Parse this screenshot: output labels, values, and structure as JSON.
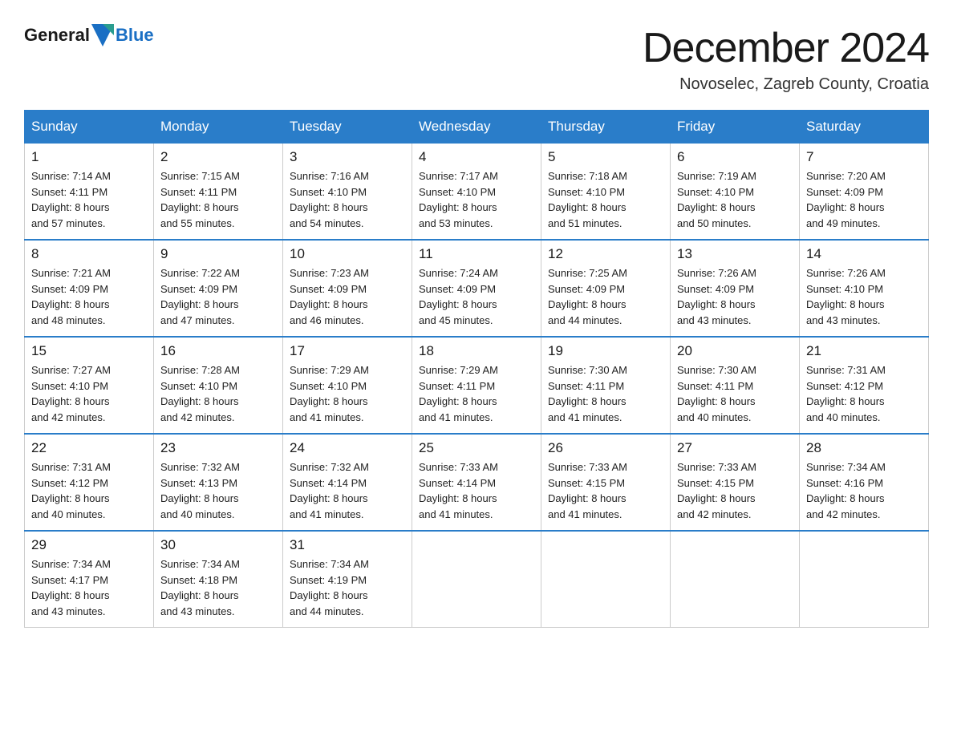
{
  "header": {
    "logo_general": "General",
    "logo_blue": "Blue",
    "month_title": "December 2024",
    "location": "Novoselec, Zagreb County, Croatia"
  },
  "days_of_week": [
    "Sunday",
    "Monday",
    "Tuesday",
    "Wednesday",
    "Thursday",
    "Friday",
    "Saturday"
  ],
  "weeks": [
    [
      {
        "day": "1",
        "sunrise": "7:14 AM",
        "sunset": "4:11 PM",
        "daylight": "8 hours and 57 minutes."
      },
      {
        "day": "2",
        "sunrise": "7:15 AM",
        "sunset": "4:11 PM",
        "daylight": "8 hours and 55 minutes."
      },
      {
        "day": "3",
        "sunrise": "7:16 AM",
        "sunset": "4:10 PM",
        "daylight": "8 hours and 54 minutes."
      },
      {
        "day": "4",
        "sunrise": "7:17 AM",
        "sunset": "4:10 PM",
        "daylight": "8 hours and 53 minutes."
      },
      {
        "day": "5",
        "sunrise": "7:18 AM",
        "sunset": "4:10 PM",
        "daylight": "8 hours and 51 minutes."
      },
      {
        "day": "6",
        "sunrise": "7:19 AM",
        "sunset": "4:10 PM",
        "daylight": "8 hours and 50 minutes."
      },
      {
        "day": "7",
        "sunrise": "7:20 AM",
        "sunset": "4:09 PM",
        "daylight": "8 hours and 49 minutes."
      }
    ],
    [
      {
        "day": "8",
        "sunrise": "7:21 AM",
        "sunset": "4:09 PM",
        "daylight": "8 hours and 48 minutes."
      },
      {
        "day": "9",
        "sunrise": "7:22 AM",
        "sunset": "4:09 PM",
        "daylight": "8 hours and 47 minutes."
      },
      {
        "day": "10",
        "sunrise": "7:23 AM",
        "sunset": "4:09 PM",
        "daylight": "8 hours and 46 minutes."
      },
      {
        "day": "11",
        "sunrise": "7:24 AM",
        "sunset": "4:09 PM",
        "daylight": "8 hours and 45 minutes."
      },
      {
        "day": "12",
        "sunrise": "7:25 AM",
        "sunset": "4:09 PM",
        "daylight": "8 hours and 44 minutes."
      },
      {
        "day": "13",
        "sunrise": "7:26 AM",
        "sunset": "4:09 PM",
        "daylight": "8 hours and 43 minutes."
      },
      {
        "day": "14",
        "sunrise": "7:26 AM",
        "sunset": "4:10 PM",
        "daylight": "8 hours and 43 minutes."
      }
    ],
    [
      {
        "day": "15",
        "sunrise": "7:27 AM",
        "sunset": "4:10 PM",
        "daylight": "8 hours and 42 minutes."
      },
      {
        "day": "16",
        "sunrise": "7:28 AM",
        "sunset": "4:10 PM",
        "daylight": "8 hours and 42 minutes."
      },
      {
        "day": "17",
        "sunrise": "7:29 AM",
        "sunset": "4:10 PM",
        "daylight": "8 hours and 41 minutes."
      },
      {
        "day": "18",
        "sunrise": "7:29 AM",
        "sunset": "4:11 PM",
        "daylight": "8 hours and 41 minutes."
      },
      {
        "day": "19",
        "sunrise": "7:30 AM",
        "sunset": "4:11 PM",
        "daylight": "8 hours and 41 minutes."
      },
      {
        "day": "20",
        "sunrise": "7:30 AM",
        "sunset": "4:11 PM",
        "daylight": "8 hours and 40 minutes."
      },
      {
        "day": "21",
        "sunrise": "7:31 AM",
        "sunset": "4:12 PM",
        "daylight": "8 hours and 40 minutes."
      }
    ],
    [
      {
        "day": "22",
        "sunrise": "7:31 AM",
        "sunset": "4:12 PM",
        "daylight": "8 hours and 40 minutes."
      },
      {
        "day": "23",
        "sunrise": "7:32 AM",
        "sunset": "4:13 PM",
        "daylight": "8 hours and 40 minutes."
      },
      {
        "day": "24",
        "sunrise": "7:32 AM",
        "sunset": "4:14 PM",
        "daylight": "8 hours and 41 minutes."
      },
      {
        "day": "25",
        "sunrise": "7:33 AM",
        "sunset": "4:14 PM",
        "daylight": "8 hours and 41 minutes."
      },
      {
        "day": "26",
        "sunrise": "7:33 AM",
        "sunset": "4:15 PM",
        "daylight": "8 hours and 41 minutes."
      },
      {
        "day": "27",
        "sunrise": "7:33 AM",
        "sunset": "4:15 PM",
        "daylight": "8 hours and 42 minutes."
      },
      {
        "day": "28",
        "sunrise": "7:34 AM",
        "sunset": "4:16 PM",
        "daylight": "8 hours and 42 minutes."
      }
    ],
    [
      {
        "day": "29",
        "sunrise": "7:34 AM",
        "sunset": "4:17 PM",
        "daylight": "8 hours and 43 minutes."
      },
      {
        "day": "30",
        "sunrise": "7:34 AM",
        "sunset": "4:18 PM",
        "daylight": "8 hours and 43 minutes."
      },
      {
        "day": "31",
        "sunrise": "7:34 AM",
        "sunset": "4:19 PM",
        "daylight": "8 hours and 44 minutes."
      },
      null,
      null,
      null,
      null
    ]
  ],
  "labels": {
    "sunrise": "Sunrise:",
    "sunset": "Sunset:",
    "daylight": "Daylight:"
  }
}
